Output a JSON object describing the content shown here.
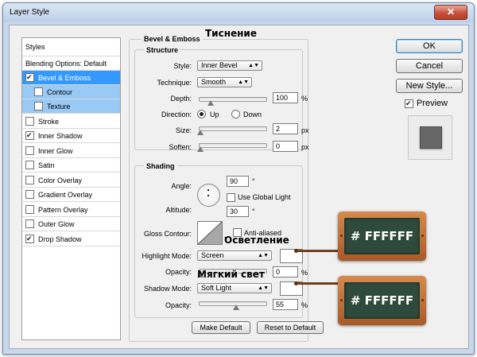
{
  "window": {
    "title": "Layer Style",
    "close_glyph": "✕"
  },
  "sidebar": {
    "items": [
      {
        "label": "Styles"
      },
      {
        "label": "Blending Options: Default"
      },
      {
        "label": "Bevel & Emboss"
      },
      {
        "label": "Contour"
      },
      {
        "label": "Texture"
      },
      {
        "label": "Stroke"
      },
      {
        "label": "Inner Shadow"
      },
      {
        "label": "Inner Glow"
      },
      {
        "label": "Satin"
      },
      {
        "label": "Color Overlay"
      },
      {
        "label": "Gradient Overlay"
      },
      {
        "label": "Pattern Overlay"
      },
      {
        "label": "Outer Glow"
      },
      {
        "label": "Drop Shadow"
      }
    ]
  },
  "panel": {
    "title": "Bevel & Emboss",
    "structure": {
      "title": "Structure",
      "style_label": "Style:",
      "style_value": "Inner Bevel",
      "technique_label": "Technique:",
      "technique_value": "Smooth",
      "depth_label": "Depth:",
      "depth_value": "100",
      "depth_unit": "%",
      "direction_label": "Direction:",
      "dir_up": "Up",
      "dir_down": "Down",
      "size_label": "Size:",
      "size_value": "2",
      "size_unit": "px",
      "soften_label": "Soften:",
      "soften_value": "0",
      "soften_unit": "px"
    },
    "shading": {
      "title": "Shading",
      "angle_label": "Angle:",
      "angle_value": "90",
      "angle_unit": "°",
      "global_light_label": "Use Global Light",
      "altitude_label": "Altitude:",
      "altitude_value": "30",
      "altitude_unit": "°",
      "gloss_label": "Gloss Contour:",
      "anti_aliased_label": "Anti-aliased",
      "highlight_mode_label": "Highlight Mode:",
      "highlight_mode_value": "Screen",
      "opacity1_label": "Opacity:",
      "opacity1_value": "0",
      "opacity1_unit": "%",
      "shadow_mode_label": "Shadow Mode:",
      "shadow_mode_value": "Soft Light",
      "opacity2_label": "Opacity:",
      "opacity2_value": "55",
      "opacity2_unit": "%"
    },
    "make_default": "Make Default",
    "reset_default": "Reset to Default"
  },
  "right": {
    "ok": "OK",
    "cancel": "Cancel",
    "new_style": "New Style...",
    "preview_label": "Preview"
  },
  "annotations": {
    "heading": "Тиснение",
    "highlight": "Осветление",
    "shadow": "Мягкий свет",
    "color1": "# FFFFFF",
    "color2": "# FFFFFF"
  }
}
